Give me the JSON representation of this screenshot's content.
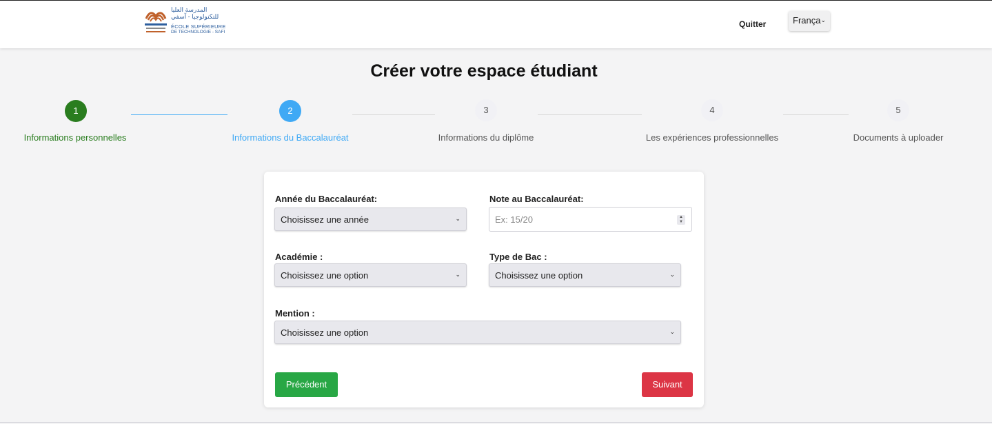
{
  "header": {
    "logo": {
      "arabic_line1": "المدرسة العليا",
      "arabic_line2": "للتكنولوجيا - آسفي",
      "french_line1": "ÉCOLE SUPÉRIEURE",
      "french_line2": "DE TECHNOLOGIE - SAFI"
    },
    "quit_label": "Quitter",
    "language": {
      "selected": "França"
    }
  },
  "page_title": "Créer votre espace étudiant",
  "stepper": {
    "steps": [
      {
        "number": "1",
        "label": "Informations personnelles",
        "state": "done"
      },
      {
        "number": "2",
        "label": "Informations du Baccalauréat",
        "state": "active"
      },
      {
        "number": "3",
        "label": "Informations du diplôme",
        "state": "todo"
      },
      {
        "number": "4",
        "label": "Les expériences professionnelles",
        "state": "todo"
      },
      {
        "number": "5",
        "label": "Documents à uploader",
        "state": "todo"
      }
    ]
  },
  "form": {
    "bac_year": {
      "label": "Année du Baccalauréat:",
      "value": "Choisissez une année"
    },
    "bac_grade": {
      "label": "Note au Baccalauréat:",
      "placeholder": "Ex: 15/20"
    },
    "academy": {
      "label": "Académie :",
      "value": "Choisissez une option"
    },
    "bac_type": {
      "label": "Type de Bac :",
      "value": "Choisissez une option"
    },
    "mention": {
      "label": "Mention :",
      "value": "Choisissez une option"
    },
    "previous_label": "Précédent",
    "next_label": "Suivant"
  },
  "colors": {
    "step_done": "#2a7d1f",
    "step_active": "#3fa9f5",
    "previous_button": "#28a745",
    "next_button": "#dc3545"
  }
}
